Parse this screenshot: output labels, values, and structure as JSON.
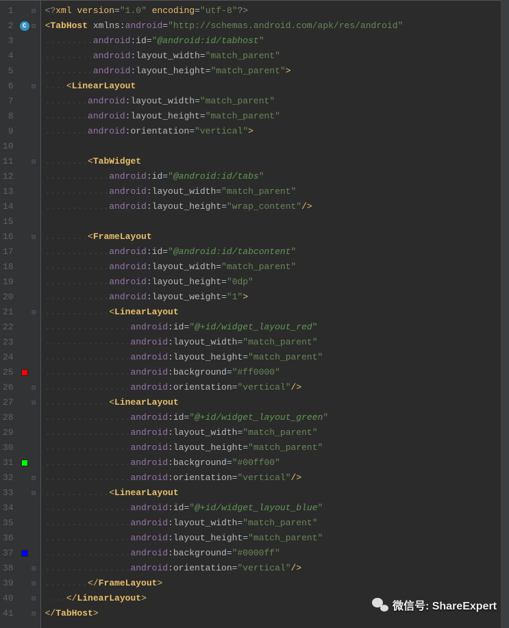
{
  "watermark": {
    "label": "微信号: ShareExpert"
  },
  "gutter": {
    "avatar_letter": "C",
    "markers": [
      {
        "line": 25,
        "color": "red"
      },
      {
        "line": 31,
        "color": "green"
      },
      {
        "line": 37,
        "color": "blue"
      }
    ],
    "fold_lines": [
      1,
      2,
      6,
      11,
      16,
      21,
      26,
      27,
      32,
      33,
      38,
      39,
      40,
      41
    ]
  },
  "code": [
    {
      "indent": 0,
      "tokens": [
        {
          "t": "xmlproc",
          "v": "<?"
        },
        {
          "t": "xmlproc-kw",
          "v": "xml version"
        },
        {
          "t": "eq",
          "v": "="
        },
        {
          "t": "q",
          "v": "\""
        },
        {
          "t": "str",
          "v": "1.0"
        },
        {
          "t": "q",
          "v": "\" "
        },
        {
          "t": "xmlproc-kw",
          "v": "encoding"
        },
        {
          "t": "eq",
          "v": "="
        },
        {
          "t": "q",
          "v": "\""
        },
        {
          "t": "str",
          "v": "utf-8"
        },
        {
          "t": "q",
          "v": "\""
        },
        {
          "t": "xmlproc",
          "v": "?>"
        }
      ]
    },
    {
      "indent": 0,
      "tokens": [
        {
          "t": "tag-br",
          "v": "<"
        },
        {
          "t": "tagname",
          "v": "TabHost "
        },
        {
          "t": "ns",
          "v": "xmlns:"
        },
        {
          "t": "attr-ns",
          "v": "android"
        },
        {
          "t": "eq",
          "v": "="
        },
        {
          "t": "q",
          "v": "\""
        },
        {
          "t": "str",
          "v": "http://schemas.android.com/apk/res/android"
        },
        {
          "t": "q",
          "v": "\""
        }
      ]
    },
    {
      "indent": 9,
      "tokens": [
        {
          "t": "attr-ns",
          "v": "android"
        },
        {
          "t": "attr",
          "v": ":id"
        },
        {
          "t": "eq",
          "v": "="
        },
        {
          "t": "q",
          "v": "\""
        },
        {
          "t": "res",
          "v": "@android:id/tabhost"
        },
        {
          "t": "q",
          "v": "\""
        }
      ]
    },
    {
      "indent": 9,
      "tokens": [
        {
          "t": "attr-ns",
          "v": "android"
        },
        {
          "t": "attr",
          "v": ":layout_width"
        },
        {
          "t": "eq",
          "v": "="
        },
        {
          "t": "q",
          "v": "\""
        },
        {
          "t": "str",
          "v": "match_parent"
        },
        {
          "t": "q",
          "v": "\""
        }
      ]
    },
    {
      "indent": 9,
      "tokens": [
        {
          "t": "attr-ns",
          "v": "android"
        },
        {
          "t": "attr",
          "v": ":layout_height"
        },
        {
          "t": "eq",
          "v": "="
        },
        {
          "t": "q",
          "v": "\""
        },
        {
          "t": "str",
          "v": "match_parent"
        },
        {
          "t": "q",
          "v": "\""
        },
        {
          "t": "tag-br",
          "v": ">"
        }
      ]
    },
    {
      "indent": 4,
      "tokens": [
        {
          "t": "tag-br",
          "v": "<"
        },
        {
          "t": "tagname",
          "v": "LinearLayout"
        }
      ]
    },
    {
      "indent": 8,
      "tokens": [
        {
          "t": "attr-ns",
          "v": "android"
        },
        {
          "t": "attr",
          "v": ":layout_width"
        },
        {
          "t": "eq",
          "v": "="
        },
        {
          "t": "q",
          "v": "\""
        },
        {
          "t": "str",
          "v": "match_parent"
        },
        {
          "t": "q",
          "v": "\""
        }
      ]
    },
    {
      "indent": 8,
      "tokens": [
        {
          "t": "attr-ns",
          "v": "android"
        },
        {
          "t": "attr",
          "v": ":layout_height"
        },
        {
          "t": "eq",
          "v": "="
        },
        {
          "t": "q",
          "v": "\""
        },
        {
          "t": "str",
          "v": "match_parent"
        },
        {
          "t": "q",
          "v": "\""
        }
      ]
    },
    {
      "indent": 8,
      "tokens": [
        {
          "t": "attr-ns",
          "v": "android"
        },
        {
          "t": "attr",
          "v": ":orientation"
        },
        {
          "t": "eq",
          "v": "="
        },
        {
          "t": "q",
          "v": "\""
        },
        {
          "t": "str",
          "v": "vertical"
        },
        {
          "t": "q",
          "v": "\""
        },
        {
          "t": "tag-br",
          "v": ">"
        }
      ]
    },
    {
      "indent": 0,
      "tokens": []
    },
    {
      "indent": 8,
      "tokens": [
        {
          "t": "tag-br",
          "v": "<"
        },
        {
          "t": "tagname",
          "v": "TabWidget"
        }
      ]
    },
    {
      "indent": 12,
      "tokens": [
        {
          "t": "attr-ns",
          "v": "android"
        },
        {
          "t": "attr",
          "v": ":id"
        },
        {
          "t": "eq",
          "v": "="
        },
        {
          "t": "q",
          "v": "\""
        },
        {
          "t": "res",
          "v": "@android:id/tabs"
        },
        {
          "t": "q",
          "v": "\""
        }
      ]
    },
    {
      "indent": 12,
      "tokens": [
        {
          "t": "attr-ns",
          "v": "android"
        },
        {
          "t": "attr",
          "v": ":layout_width"
        },
        {
          "t": "eq",
          "v": "="
        },
        {
          "t": "q",
          "v": "\""
        },
        {
          "t": "str",
          "v": "match_parent"
        },
        {
          "t": "q",
          "v": "\""
        }
      ]
    },
    {
      "indent": 12,
      "tokens": [
        {
          "t": "attr-ns",
          "v": "android"
        },
        {
          "t": "attr",
          "v": ":layout_height"
        },
        {
          "t": "eq",
          "v": "="
        },
        {
          "t": "q",
          "v": "\""
        },
        {
          "t": "str",
          "v": "wrap_content"
        },
        {
          "t": "q",
          "v": "\""
        },
        {
          "t": "tag-br",
          "v": "/>"
        }
      ]
    },
    {
      "indent": 0,
      "tokens": []
    },
    {
      "indent": 8,
      "tokens": [
        {
          "t": "tag-br",
          "v": "<"
        },
        {
          "t": "tagname",
          "v": "FrameLayout"
        }
      ]
    },
    {
      "indent": 12,
      "tokens": [
        {
          "t": "attr-ns",
          "v": "android"
        },
        {
          "t": "attr",
          "v": ":id"
        },
        {
          "t": "eq",
          "v": "="
        },
        {
          "t": "q",
          "v": "\""
        },
        {
          "t": "res",
          "v": "@android:id/tabcontent"
        },
        {
          "t": "q",
          "v": "\""
        }
      ]
    },
    {
      "indent": 12,
      "tokens": [
        {
          "t": "attr-ns",
          "v": "android"
        },
        {
          "t": "attr",
          "v": ":layout_width"
        },
        {
          "t": "eq",
          "v": "="
        },
        {
          "t": "q",
          "v": "\""
        },
        {
          "t": "str",
          "v": "match_parent"
        },
        {
          "t": "q",
          "v": "\""
        }
      ]
    },
    {
      "indent": 12,
      "tokens": [
        {
          "t": "attr-ns",
          "v": "android"
        },
        {
          "t": "attr",
          "v": ":layout_height"
        },
        {
          "t": "eq",
          "v": "="
        },
        {
          "t": "q",
          "v": "\""
        },
        {
          "t": "str",
          "v": "0dp"
        },
        {
          "t": "q",
          "v": "\""
        }
      ]
    },
    {
      "indent": 12,
      "tokens": [
        {
          "t": "attr-ns",
          "v": "android"
        },
        {
          "t": "attr",
          "v": ":layout_weight"
        },
        {
          "t": "eq",
          "v": "="
        },
        {
          "t": "q",
          "v": "\""
        },
        {
          "t": "str",
          "v": "1"
        },
        {
          "t": "q",
          "v": "\""
        },
        {
          "t": "tag-br",
          "v": ">"
        }
      ]
    },
    {
      "indent": 12,
      "tokens": [
        {
          "t": "tag-br",
          "v": "<"
        },
        {
          "t": "tagname",
          "v": "LinearLayout"
        }
      ]
    },
    {
      "indent": 16,
      "tokens": [
        {
          "t": "attr-ns",
          "v": "android"
        },
        {
          "t": "attr",
          "v": ":id"
        },
        {
          "t": "eq",
          "v": "="
        },
        {
          "t": "q",
          "v": "\""
        },
        {
          "t": "res",
          "v": "@+id/widget_layout_red"
        },
        {
          "t": "q",
          "v": "\""
        }
      ]
    },
    {
      "indent": 16,
      "tokens": [
        {
          "t": "attr-ns",
          "v": "android"
        },
        {
          "t": "attr",
          "v": ":layout_width"
        },
        {
          "t": "eq",
          "v": "="
        },
        {
          "t": "q",
          "v": "\""
        },
        {
          "t": "str",
          "v": "match_parent"
        },
        {
          "t": "q",
          "v": "\""
        }
      ]
    },
    {
      "indent": 16,
      "tokens": [
        {
          "t": "attr-ns",
          "v": "android"
        },
        {
          "t": "attr",
          "v": ":layout_height"
        },
        {
          "t": "eq",
          "v": "="
        },
        {
          "t": "q",
          "v": "\""
        },
        {
          "t": "str",
          "v": "match_parent"
        },
        {
          "t": "q",
          "v": "\""
        }
      ]
    },
    {
      "indent": 16,
      "tokens": [
        {
          "t": "attr-ns",
          "v": "android"
        },
        {
          "t": "attr",
          "v": ":background"
        },
        {
          "t": "eq",
          "v": "="
        },
        {
          "t": "q",
          "v": "\""
        },
        {
          "t": "str",
          "v": "#ff0000"
        },
        {
          "t": "q",
          "v": "\""
        }
      ]
    },
    {
      "indent": 16,
      "tokens": [
        {
          "t": "attr-ns",
          "v": "android"
        },
        {
          "t": "attr",
          "v": ":orientation"
        },
        {
          "t": "eq",
          "v": "="
        },
        {
          "t": "q",
          "v": "\""
        },
        {
          "t": "str",
          "v": "vertical"
        },
        {
          "t": "q",
          "v": "\""
        },
        {
          "t": "tag-br",
          "v": "/>"
        }
      ]
    },
    {
      "indent": 12,
      "tokens": [
        {
          "t": "tag-br",
          "v": "<"
        },
        {
          "t": "tagname",
          "v": "LinearLayout"
        }
      ]
    },
    {
      "indent": 16,
      "tokens": [
        {
          "t": "attr-ns",
          "v": "android"
        },
        {
          "t": "attr",
          "v": ":id"
        },
        {
          "t": "eq",
          "v": "="
        },
        {
          "t": "q",
          "v": "\""
        },
        {
          "t": "res",
          "v": "@+id/widget_layout_green"
        },
        {
          "t": "q",
          "v": "\""
        }
      ]
    },
    {
      "indent": 16,
      "tokens": [
        {
          "t": "attr-ns",
          "v": "android"
        },
        {
          "t": "attr",
          "v": ":layout_width"
        },
        {
          "t": "eq",
          "v": "="
        },
        {
          "t": "q",
          "v": "\""
        },
        {
          "t": "str",
          "v": "match_parent"
        },
        {
          "t": "q",
          "v": "\""
        }
      ]
    },
    {
      "indent": 16,
      "tokens": [
        {
          "t": "attr-ns",
          "v": "android"
        },
        {
          "t": "attr",
          "v": ":layout_height"
        },
        {
          "t": "eq",
          "v": "="
        },
        {
          "t": "q",
          "v": "\""
        },
        {
          "t": "str",
          "v": "match_parent"
        },
        {
          "t": "q",
          "v": "\""
        }
      ]
    },
    {
      "indent": 16,
      "tokens": [
        {
          "t": "attr-ns",
          "v": "android"
        },
        {
          "t": "attr",
          "v": ":background"
        },
        {
          "t": "eq",
          "v": "="
        },
        {
          "t": "q",
          "v": "\""
        },
        {
          "t": "str",
          "v": "#00ff00"
        },
        {
          "t": "q",
          "v": "\""
        }
      ]
    },
    {
      "indent": 16,
      "tokens": [
        {
          "t": "attr-ns",
          "v": "android"
        },
        {
          "t": "attr",
          "v": ":orientation"
        },
        {
          "t": "eq",
          "v": "="
        },
        {
          "t": "q",
          "v": "\""
        },
        {
          "t": "str",
          "v": "vertical"
        },
        {
          "t": "q",
          "v": "\""
        },
        {
          "t": "tag-br",
          "v": "/>"
        }
      ]
    },
    {
      "indent": 12,
      "tokens": [
        {
          "t": "tag-br",
          "v": "<"
        },
        {
          "t": "tagname",
          "v": "LinearLayout"
        }
      ]
    },
    {
      "indent": 16,
      "tokens": [
        {
          "t": "attr-ns",
          "v": "android"
        },
        {
          "t": "attr",
          "v": ":id"
        },
        {
          "t": "eq",
          "v": "="
        },
        {
          "t": "q",
          "v": "\""
        },
        {
          "t": "res",
          "v": "@+id/widget_layout_blue"
        },
        {
          "t": "q",
          "v": "\""
        }
      ]
    },
    {
      "indent": 16,
      "tokens": [
        {
          "t": "attr-ns",
          "v": "android"
        },
        {
          "t": "attr",
          "v": ":layout_width"
        },
        {
          "t": "eq",
          "v": "="
        },
        {
          "t": "q",
          "v": "\""
        },
        {
          "t": "str",
          "v": "match_parent"
        },
        {
          "t": "q",
          "v": "\""
        }
      ]
    },
    {
      "indent": 16,
      "tokens": [
        {
          "t": "attr-ns",
          "v": "android"
        },
        {
          "t": "attr",
          "v": ":layout_height"
        },
        {
          "t": "eq",
          "v": "="
        },
        {
          "t": "q",
          "v": "\""
        },
        {
          "t": "str",
          "v": "match_parent"
        },
        {
          "t": "q",
          "v": "\""
        }
      ]
    },
    {
      "indent": 16,
      "tokens": [
        {
          "t": "attr-ns",
          "v": "android"
        },
        {
          "t": "attr",
          "v": ":background"
        },
        {
          "t": "eq",
          "v": "="
        },
        {
          "t": "q",
          "v": "\""
        },
        {
          "t": "str",
          "v": "#0000ff"
        },
        {
          "t": "q",
          "v": "\""
        }
      ]
    },
    {
      "indent": 16,
      "tokens": [
        {
          "t": "attr-ns",
          "v": "android"
        },
        {
          "t": "attr",
          "v": ":orientation"
        },
        {
          "t": "eq",
          "v": "="
        },
        {
          "t": "q",
          "v": "\""
        },
        {
          "t": "str",
          "v": "vertical"
        },
        {
          "t": "q",
          "v": "\""
        },
        {
          "t": "tag-br",
          "v": "/>"
        }
      ]
    },
    {
      "indent": 8,
      "tokens": [
        {
          "t": "tag-br",
          "v": "</"
        },
        {
          "t": "tagname",
          "v": "FrameLayout"
        },
        {
          "t": "tag-br",
          "v": ">"
        }
      ]
    },
    {
      "indent": 4,
      "tokens": [
        {
          "t": "tag-br",
          "v": "</"
        },
        {
          "t": "tagname",
          "v": "LinearLayout"
        },
        {
          "t": "tag-br",
          "v": ">"
        }
      ]
    },
    {
      "indent": 0,
      "tokens": [
        {
          "t": "tag-br",
          "v": "</"
        },
        {
          "t": "tagname",
          "v": "TabHost"
        },
        {
          "t": "tag-br",
          "v": ">"
        }
      ]
    }
  ]
}
